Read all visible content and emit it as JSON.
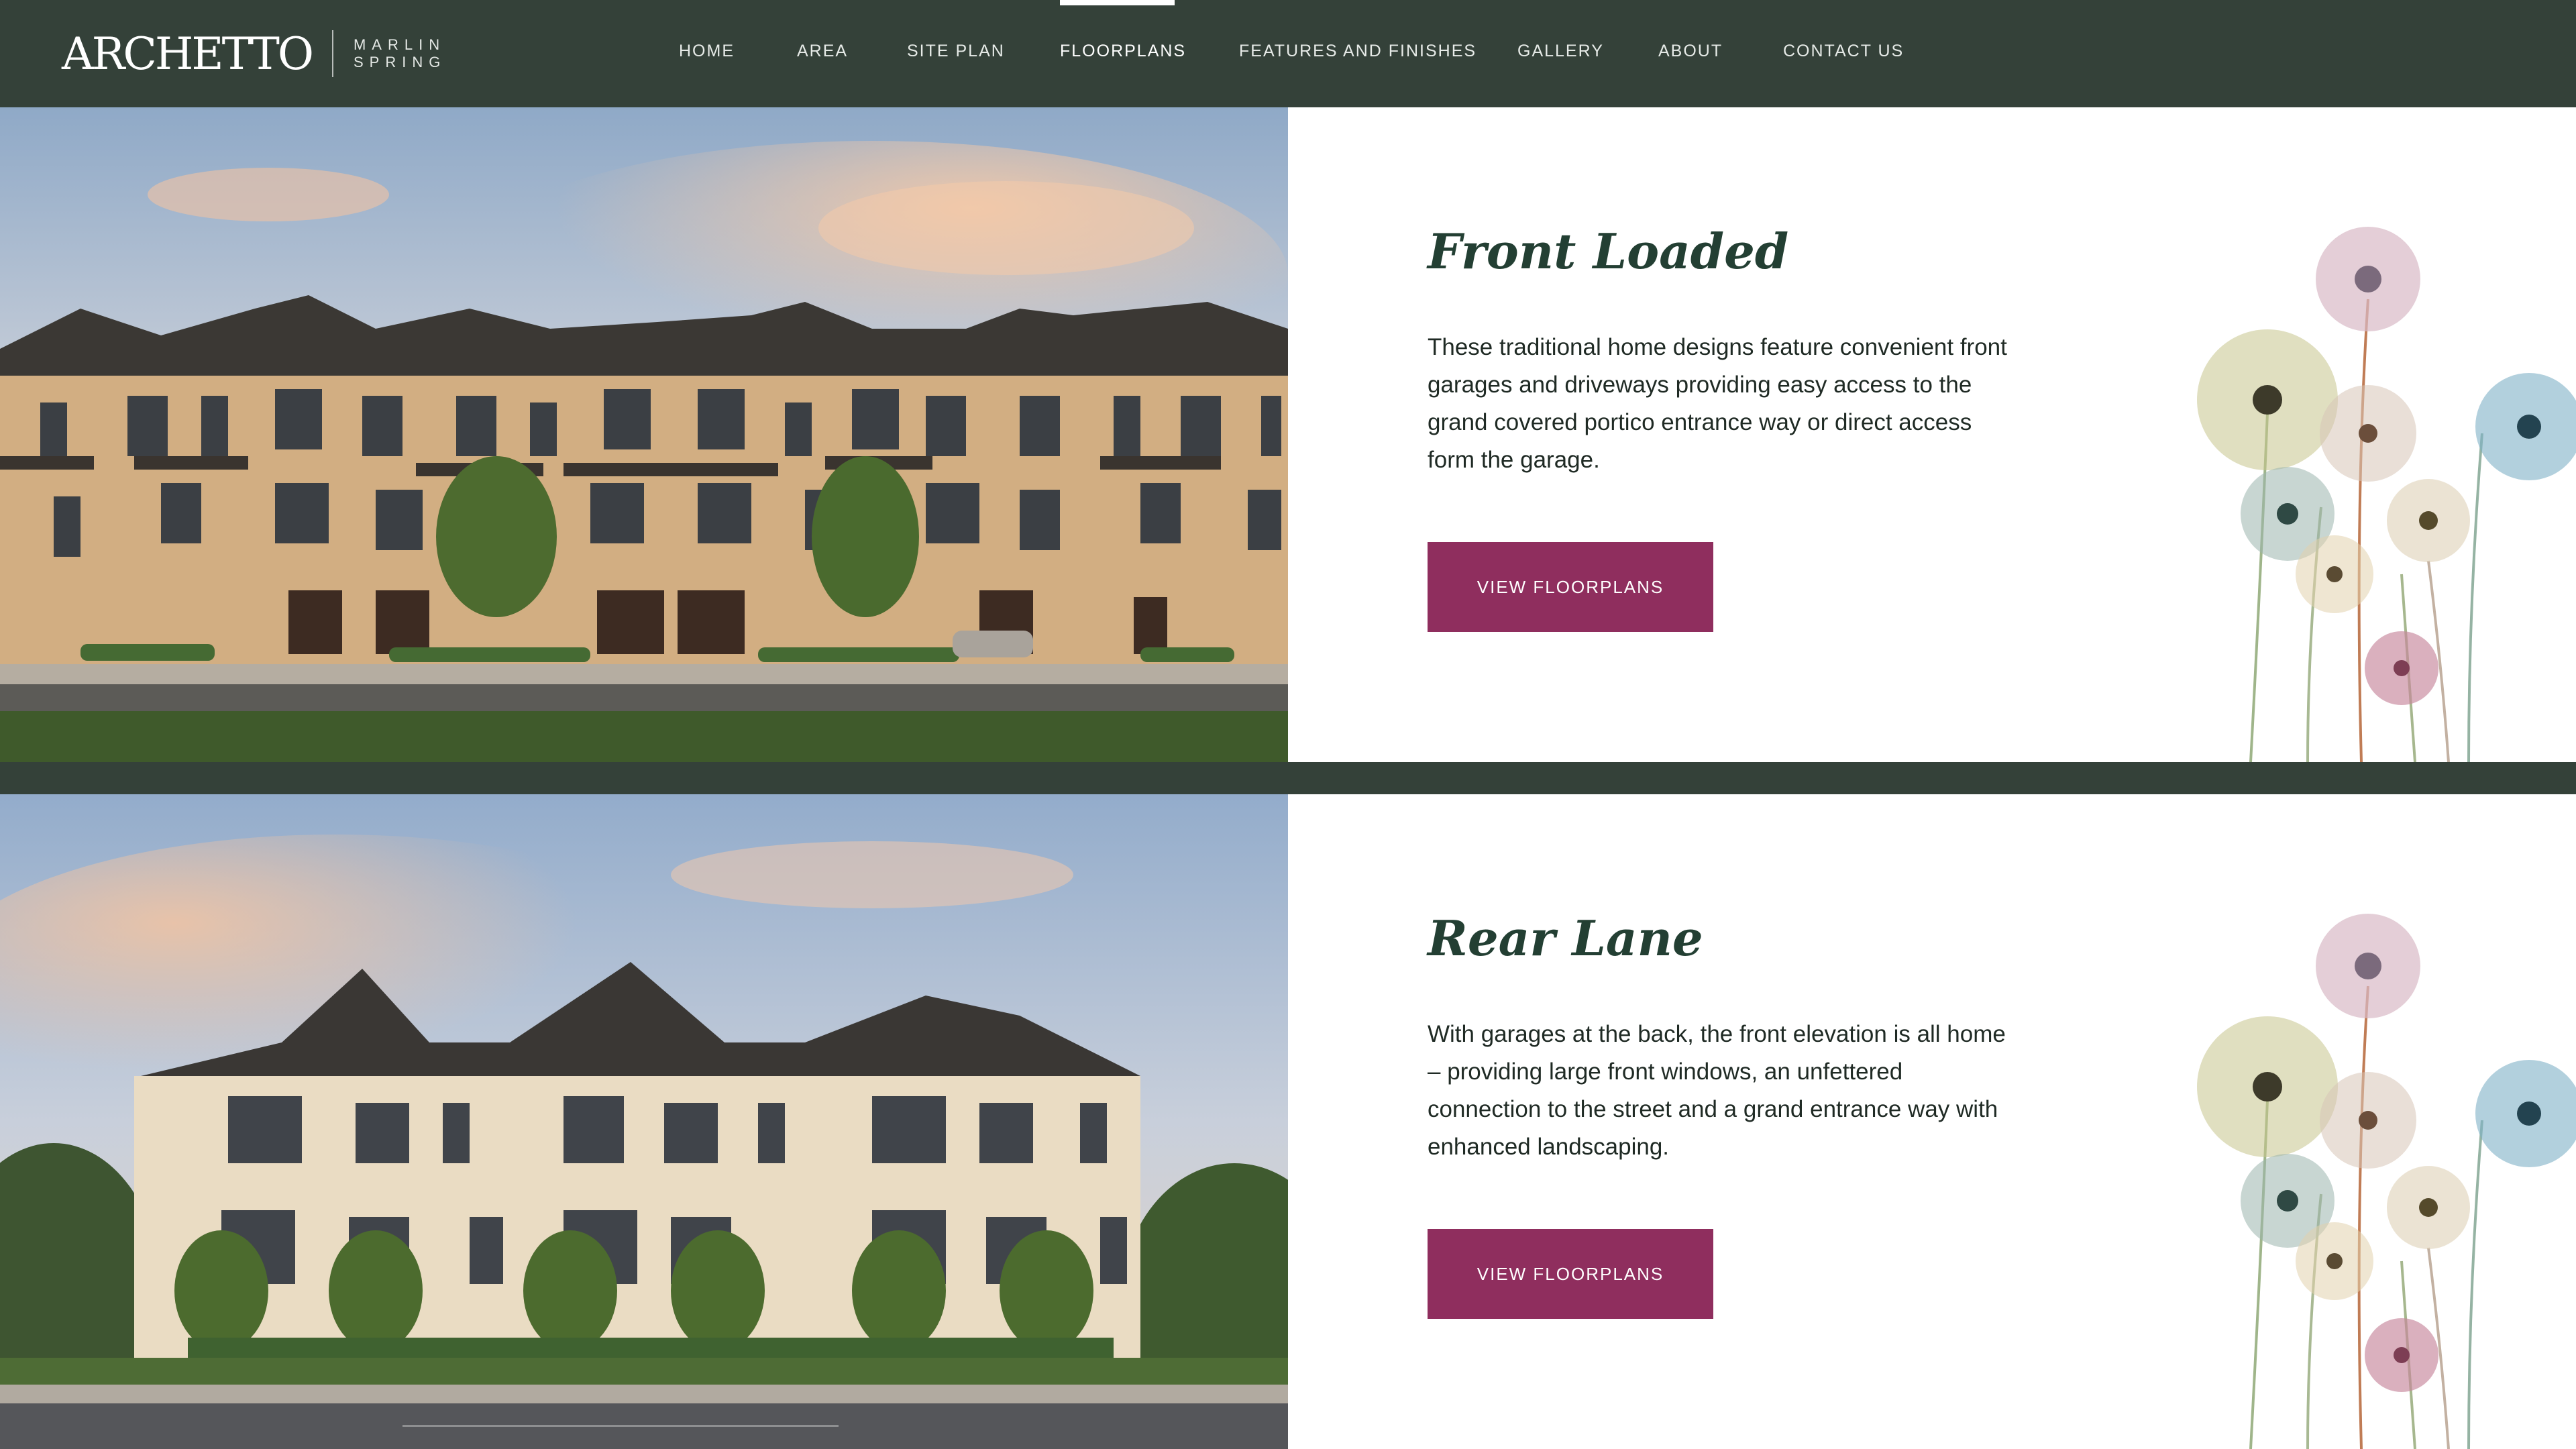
{
  "brand": {
    "logo_word": "ARCHETTO",
    "sub_line1": "MARLIN",
    "sub_line2": "SPRING"
  },
  "nav": {
    "items": [
      {
        "label": "HOME"
      },
      {
        "label": "AREA"
      },
      {
        "label": "SITE PLAN"
      },
      {
        "label": "FLOORPLANS",
        "active": true
      },
      {
        "label": "FEATURES AND FINISHES"
      },
      {
        "label": "GALLERY"
      },
      {
        "label": "ABOUT"
      },
      {
        "label": "CONTACT US"
      }
    ]
  },
  "sections": [
    {
      "title": "Front Loaded",
      "description": "These traditional home designs feature convenient front garages and driveways providing easy access to the grand covered portico entrance way or direct access form the garage.",
      "button_label": "VIEW FLOORPLANS"
    },
    {
      "title": "Rear Lane",
      "description": "With garages at the back, the front elevation is all home – providing large front windows, an unfettered connection to the street and a grand entrance way with enhanced landscaping.",
      "button_label": "VIEW FLOORPLANS"
    }
  ],
  "colors": {
    "header_bg": "#344139",
    "accent": "#8f2e5e",
    "heading": "#233f33"
  }
}
